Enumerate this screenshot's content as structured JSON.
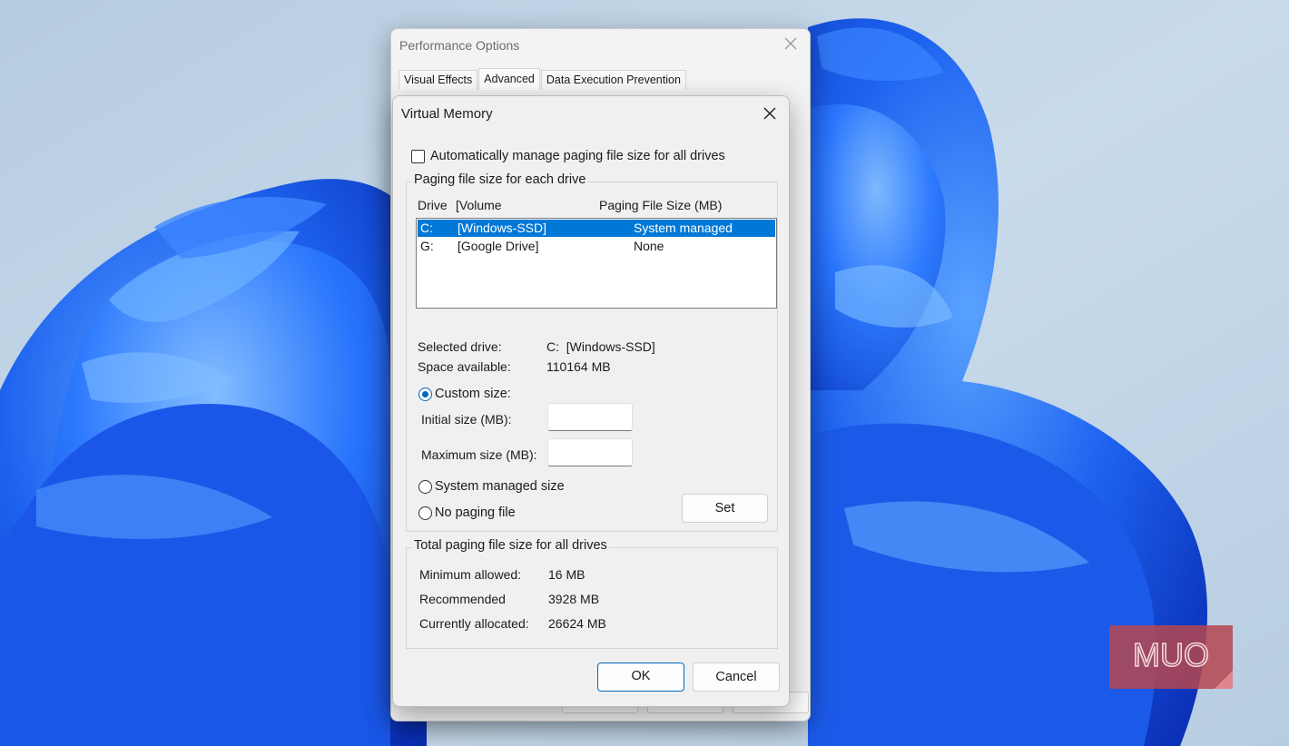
{
  "performance_options": {
    "title": "Performance Options",
    "tabs": [
      "Visual Effects",
      "Advanced",
      "Data Execution Prevention"
    ],
    "active_tab": "Advanced"
  },
  "virtual_memory": {
    "title": "Virtual Memory",
    "auto_manage": {
      "label": "Automatically manage paging file size for all drives",
      "checked": false
    },
    "per_drive_group": {
      "title": "Paging file size for each drive",
      "headers": {
        "drive": "Drive",
        "volume": "[Volume",
        "size": "Paging File Size (MB)"
      },
      "drives": [
        {
          "letter": "C:",
          "volume": "[Windows-SSD]",
          "size": "System managed",
          "selected": true
        },
        {
          "letter": "G:",
          "volume": "[Google Drive]",
          "size": "None",
          "selected": false
        }
      ],
      "selected_drive_label": "Selected drive:",
      "selected_drive_value": "C:  [Windows-SSD]",
      "space_available_label": "Space available:",
      "space_available_value": "110164 MB",
      "custom_size_label": "Custom size:",
      "initial_size_label": "Initial size (MB):",
      "initial_size_value": "",
      "maximum_size_label": "Maximum size (MB):",
      "maximum_size_value": "",
      "system_managed_label": "System managed size",
      "no_paging_label": "No paging file",
      "selected_option": "custom",
      "set_button": "Set"
    },
    "totals_group": {
      "title": "Total paging file size for all drives",
      "minimum_label": "Minimum allowed:",
      "minimum_value": "16 MB",
      "recommended_label": "Recommended",
      "recommended_value": "3928 MB",
      "allocated_label": "Currently allocated:",
      "allocated_value": "26624 MB"
    },
    "ok_button": "OK",
    "cancel_button": "Cancel"
  },
  "watermark": {
    "text": "MUO"
  },
  "colors": {
    "accent": "#0078d7",
    "desktop_bg": "#c7d9ea",
    "bloom": "#1656e6"
  },
  "icons": [
    "close-icon",
    "checkbox",
    "radio"
  ]
}
